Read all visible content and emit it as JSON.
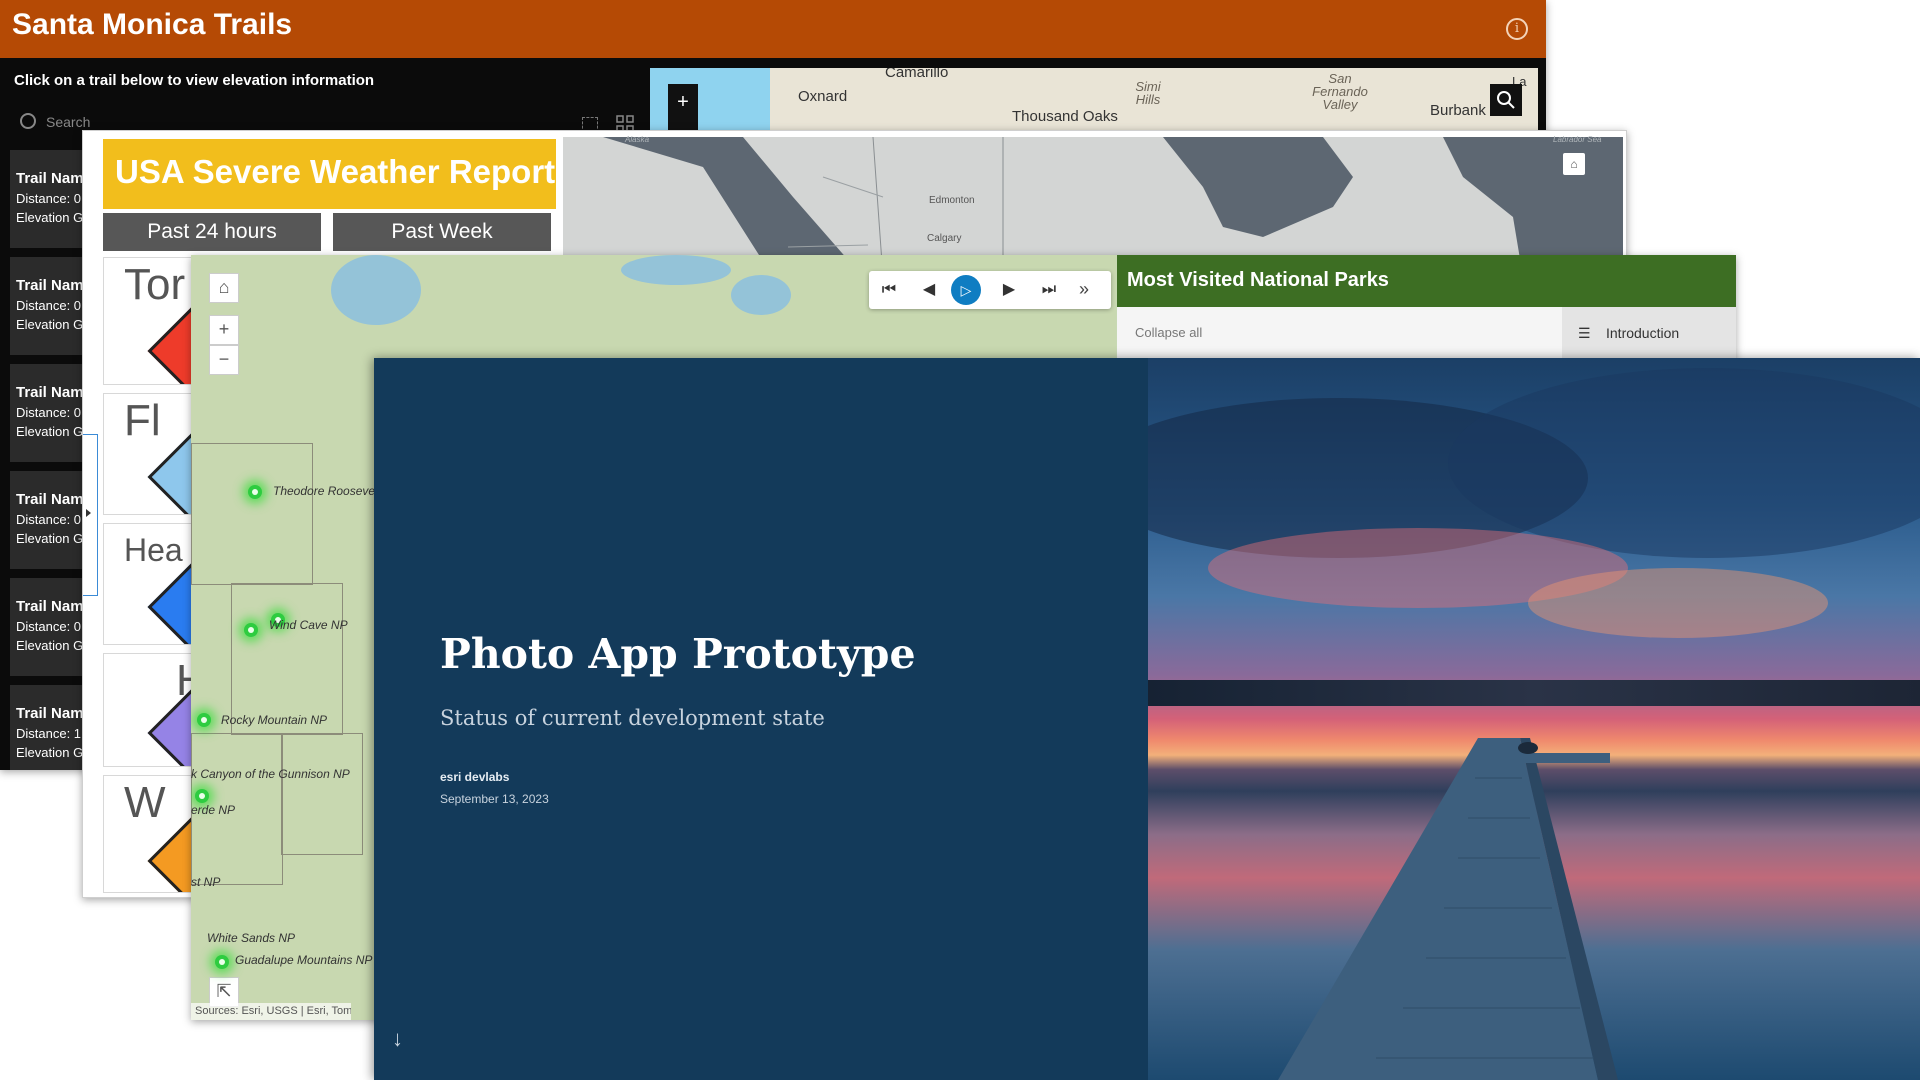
{
  "trails_app": {
    "title": "Santa Monica Trails",
    "instruction": "Click on a trail below to view elevation information",
    "search_placeholder": "Search",
    "trail_items": [
      {
        "name": "Trail Nam",
        "distance": "Distance: 0",
        "elevation": "Elevation G"
      },
      {
        "name": "Trail Nam",
        "distance": "Distance: 0",
        "elevation": "Elevation G"
      },
      {
        "name": "Trail Nam",
        "distance": "Distance: 0",
        "elevation": "Elevation G"
      },
      {
        "name": "Trail Nam",
        "distance": "Distance: 0",
        "elevation": "Elevation G"
      },
      {
        "name": "Trail Nam",
        "distance": "Distance: 0",
        "elevation": "Elevation G"
      },
      {
        "name": "Trail Nam",
        "distance": "Distance: 1",
        "elevation": "Elevation G"
      }
    ],
    "map_labels": {
      "camarillo": "Camarillo",
      "oxnard": "Oxnard",
      "simi_hills": "Simi Hills",
      "thousand_oaks": "Thousand Oaks",
      "san_fernando_valley": "San Fernando Valley",
      "burbank": "Burbank",
      "la": "La C"
    },
    "zoom_in": "+",
    "icons": {
      "info": "info-icon",
      "search": "search-icon",
      "clear": "clear-selection-icon",
      "grid": "grid-icon"
    },
    "header_color": "#b54a05"
  },
  "weather_app": {
    "title": "USA Severe Weather Reports",
    "tabs": [
      "Past 24 hours",
      "Past Week"
    ],
    "categories": [
      "Tor",
      "Fl",
      "Hea",
      "H",
      "W"
    ],
    "map_labels": {
      "edmonton": "Edmonton",
      "calgary": "Calgary",
      "labrador_sea": "Labrador Sea",
      "alaska": "Alaska"
    },
    "banner_color": "#f2be1c"
  },
  "parks_app": {
    "panel_title": "Most Visited National Parks",
    "collapse_all": "Collapse all",
    "introduction": "Introduction",
    "zoom_in": "+",
    "zoom_out": "−",
    "parks": [
      "Theodore Rooseve",
      "Wind Cave NP",
      "Rocky Mountain NP",
      "k Canyon of the Gunnison NP",
      "erde NP",
      "st NP",
      "White Sands NP",
      "Guadalupe Mountains NP"
    ],
    "attribution": "Sources: Esri, USGS | Esri, TomTom",
    "header_color": "#3d6e23"
  },
  "photo_app": {
    "title": "Photo App Prototype",
    "subtitle": "Status of current development state",
    "author": "esri devlabs",
    "date": "September 13, 2023",
    "scroll_arrow": "↓",
    "background_color": "#133a5a"
  }
}
